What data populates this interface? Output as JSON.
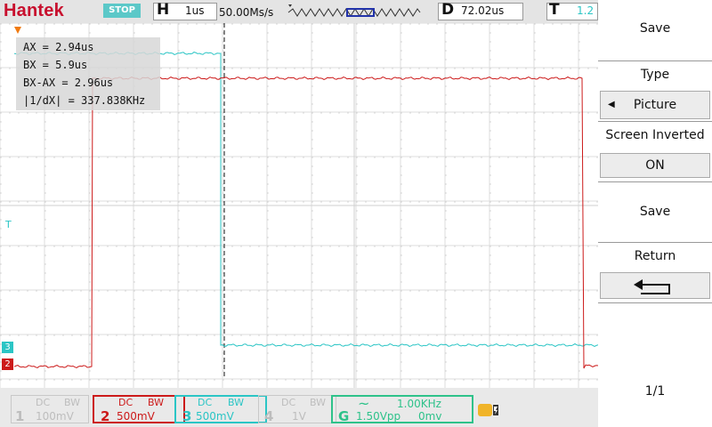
{
  "top_bar": {
    "brand": "Hantek",
    "run_state": "STOP",
    "timebase_letter": "H",
    "timebase_value": "1us",
    "sample_rate": "50.00Ms/s",
    "delay_letter": "D",
    "delay_value": "72.02us",
    "trigger_letter": "T",
    "trigger_value": "1.2"
  },
  "measurements": {
    "ax": "AX      = 2.94us",
    "bx": "BX      = 5.9us",
    "bx_ax": "BX-AX = 2.96us",
    "freq": "|1/dX|    = 337.838KHz"
  },
  "markers": {
    "trigger_level": "T",
    "ch3": "3",
    "ch2": "2"
  },
  "menu": {
    "title": "Save",
    "type_label": "Type",
    "type_value": "Picture",
    "screen_inverted_label": "Screen Inverted",
    "screen_inverted_value": "ON",
    "save_button": "Save",
    "return_label": "Return",
    "page": "1/1"
  },
  "channels": [
    {
      "num": "1",
      "coupling": "DC",
      "bw": "BW",
      "scale": "100mV",
      "color": "#bdbdbd"
    },
    {
      "num": "2",
      "coupling": "DC",
      "bw": "BW",
      "scale": "500mV",
      "color": "#cc1a1a"
    },
    {
      "num": "3",
      "coupling": "DC",
      "bw": "BW",
      "scale": "500mV",
      "color": "#2bc5c5"
    },
    {
      "num": "4",
      "coupling": "DC",
      "bw": "BW",
      "scale": "1V",
      "color": "#bdbdbd"
    }
  ],
  "generator": {
    "letter": "G",
    "wave": "~",
    "freq": "1.00KHz",
    "amp": "1.50Vpp",
    "offset": "0mv",
    "color": "#2ec28a"
  },
  "colors": {
    "ch2": "#cc1a1a",
    "ch3": "#2bc5c5",
    "cursor": "#000000"
  }
}
